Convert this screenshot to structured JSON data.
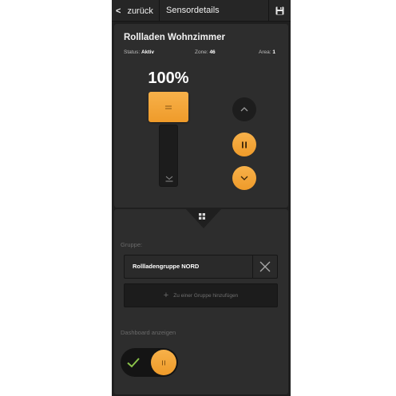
{
  "header": {
    "back_label": "zurück",
    "title": "Sensordetails",
    "save_icon": "floppy-disk-icon"
  },
  "device": {
    "name": "Rollladen Wohnzimmer",
    "status_label": "Status:",
    "status_value": "Aktiv",
    "zone_label": "Zone:",
    "zone_value": "46",
    "area_label": "Area:",
    "area_value": "1",
    "position_text": "100%",
    "position_fraction": 1.0
  },
  "controls": {
    "up_icon": "chevron-up-icon",
    "pause_icon": "pause-icon",
    "down_icon": "chevron-down-icon"
  },
  "groups": {
    "section_label": "Gruppe:",
    "items": [
      {
        "name": "Rollladengruppe NORD"
      }
    ],
    "add_label": "Zu einer Gruppe hinzufügen"
  },
  "dashboard": {
    "section_label": "Dashboard anzeigen",
    "enabled": true
  },
  "colors": {
    "accent": "#F4A63A",
    "background": "#1F1F1F",
    "card": "#2D2D2D",
    "check": "#8BC34A"
  }
}
